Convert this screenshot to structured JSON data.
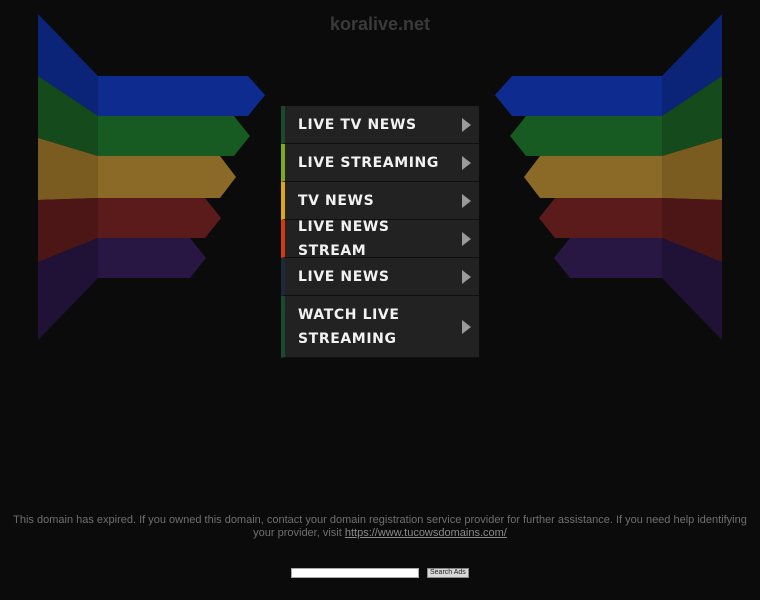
{
  "header": {
    "title": "koralive.net"
  },
  "menu": {
    "items": [
      {
        "label": "LIVE TV NEWS",
        "accent": "#1a4a2e",
        "arrow": "chevron-right-icon"
      },
      {
        "label": "LIVE STREAMING",
        "accent": "#7faa1f",
        "arrow": "chevron-right-icon"
      },
      {
        "label": "TV NEWS",
        "accent": "#e0a61a",
        "arrow": "chevron-right-icon"
      },
      {
        "label": "LIVE NEWS STREAM",
        "accent": "#d23a12",
        "arrow": "chevron-right-icon"
      },
      {
        "label": "LIVE NEWS",
        "accent": "#1c2a3a",
        "arrow": "chevron-right-icon"
      },
      {
        "label": "WATCH LIVE STREAMING",
        "accent": "#1a4a2e",
        "arrow": "chevron-right-icon"
      }
    ]
  },
  "footer": {
    "notice_text": "This domain has expired. If you owned this domain, contact your domain registration service provider for further assistance. If you need help identifying your provider, visit ",
    "notice_link": "https://www.tucowsdomains.com/",
    "search_placeholder": "",
    "search_button": "Search Ads"
  },
  "colors": {
    "background": "#0b0b0b",
    "ribbon_blue": "#0d2a8a",
    "ribbon_green": "#15551f",
    "ribbon_gold": "#8a6a22",
    "ribbon_red": "#5a1a1a",
    "ribbon_purple": "#26163f"
  }
}
